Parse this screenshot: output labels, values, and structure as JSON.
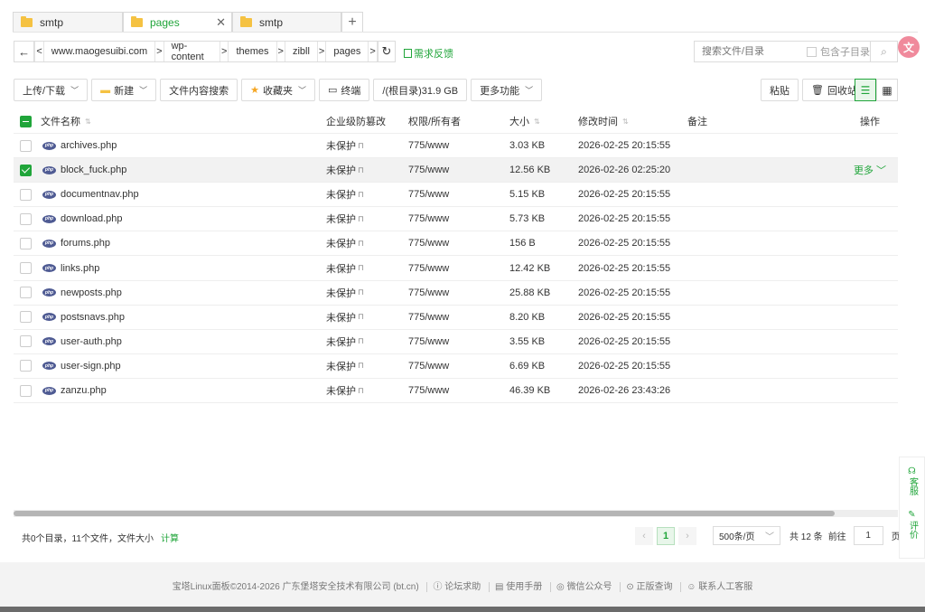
{
  "tabs": [
    {
      "label": "smtp",
      "active": false
    },
    {
      "label": "pages",
      "active": true
    },
    {
      "label": "smtp",
      "active": false
    }
  ],
  "tab_add": "+",
  "tab_close": "✕",
  "breadcrumb": [
    "www.maogesuibi.com",
    "wp-content",
    "themes",
    "zibll",
    "pages"
  ],
  "feedback_label": "需求反馈",
  "search": {
    "placeholder": "搜索文件/目录",
    "include_sub_label": "包含子目录"
  },
  "toolbar": {
    "upload_download": "上传/下载",
    "new": "新建",
    "content_search": "文件内容搜索",
    "favorites": "收藏夹",
    "terminal": "终端",
    "disk": "/(根目录)31.9 GB",
    "more": "更多功能",
    "paste": "粘贴",
    "recycle": "回收站"
  },
  "table": {
    "headers": {
      "name": "文件名称",
      "protect": "企业级防篡改",
      "perm": "权限/所有者",
      "size": "大小",
      "mtime": "修改时间",
      "note": "备注",
      "op": "操作"
    },
    "rows": [
      {
        "name": "archives.php",
        "protect": "未保护",
        "perm": "775/www",
        "size": "3.03 KB",
        "mtime": "2026-02-25 20:15:55",
        "selected": false
      },
      {
        "name": "block_fuck.php",
        "protect": "未保护",
        "perm": "775/www",
        "size": "12.56 KB",
        "mtime": "2026-02-26 02:25:20",
        "selected": true,
        "more": "更多"
      },
      {
        "name": "documentnav.php",
        "protect": "未保护",
        "perm": "775/www",
        "size": "5.15 KB",
        "mtime": "2026-02-25 20:15:55",
        "selected": false
      },
      {
        "name": "download.php",
        "protect": "未保护",
        "perm": "775/www",
        "size": "5.73 KB",
        "mtime": "2026-02-25 20:15:55",
        "selected": false
      },
      {
        "name": "forums.php",
        "protect": "未保护",
        "perm": "775/www",
        "size": "156 B",
        "mtime": "2026-02-25 20:15:55",
        "selected": false
      },
      {
        "name": "links.php",
        "protect": "未保护",
        "perm": "775/www",
        "size": "12.42 KB",
        "mtime": "2026-02-25 20:15:55",
        "selected": false
      },
      {
        "name": "newposts.php",
        "protect": "未保护",
        "perm": "775/www",
        "size": "25.88 KB",
        "mtime": "2026-02-25 20:15:55",
        "selected": false
      },
      {
        "name": "postsnavs.php",
        "protect": "未保护",
        "perm": "775/www",
        "size": "8.20 KB",
        "mtime": "2026-02-25 20:15:55",
        "selected": false
      },
      {
        "name": "user-auth.php",
        "protect": "未保护",
        "perm": "775/www",
        "size": "3.55 KB",
        "mtime": "2026-02-25 20:15:55",
        "selected": false
      },
      {
        "name": "user-sign.php",
        "protect": "未保护",
        "perm": "775/www",
        "size": "6.69 KB",
        "mtime": "2026-02-25 20:15:55",
        "selected": false
      },
      {
        "name": "zanzu.php",
        "protect": "未保护",
        "perm": "775/www",
        "size": "46.39 KB",
        "mtime": "2026-02-26 23:43:26",
        "selected": false
      }
    ]
  },
  "footer": {
    "summary": "共0个目录，11个文件，文件大小",
    "calc": "计算",
    "current_page": "1",
    "page_size": "500条/页",
    "total": "共 12 条",
    "goto_label": "前往",
    "goto_value": "1",
    "page_unit": "页"
  },
  "copyright": "宝塔Linux面板©2014-2026 广东堡塔安全技术有限公司 (bt.cn)",
  "footer_links": [
    "论坛求助",
    "使用手册",
    "微信公众号",
    "正版查询",
    "联系人工客服"
  ],
  "side": {
    "service": "客服",
    "review": "评价"
  },
  "float_avatar": "文",
  "icons": {
    "folder": "folder-icon",
    "php": "php-file-icon"
  },
  "colors": {
    "accent": "#20a53a",
    "folder": "#f5c242",
    "php": "#4f5b93"
  }
}
